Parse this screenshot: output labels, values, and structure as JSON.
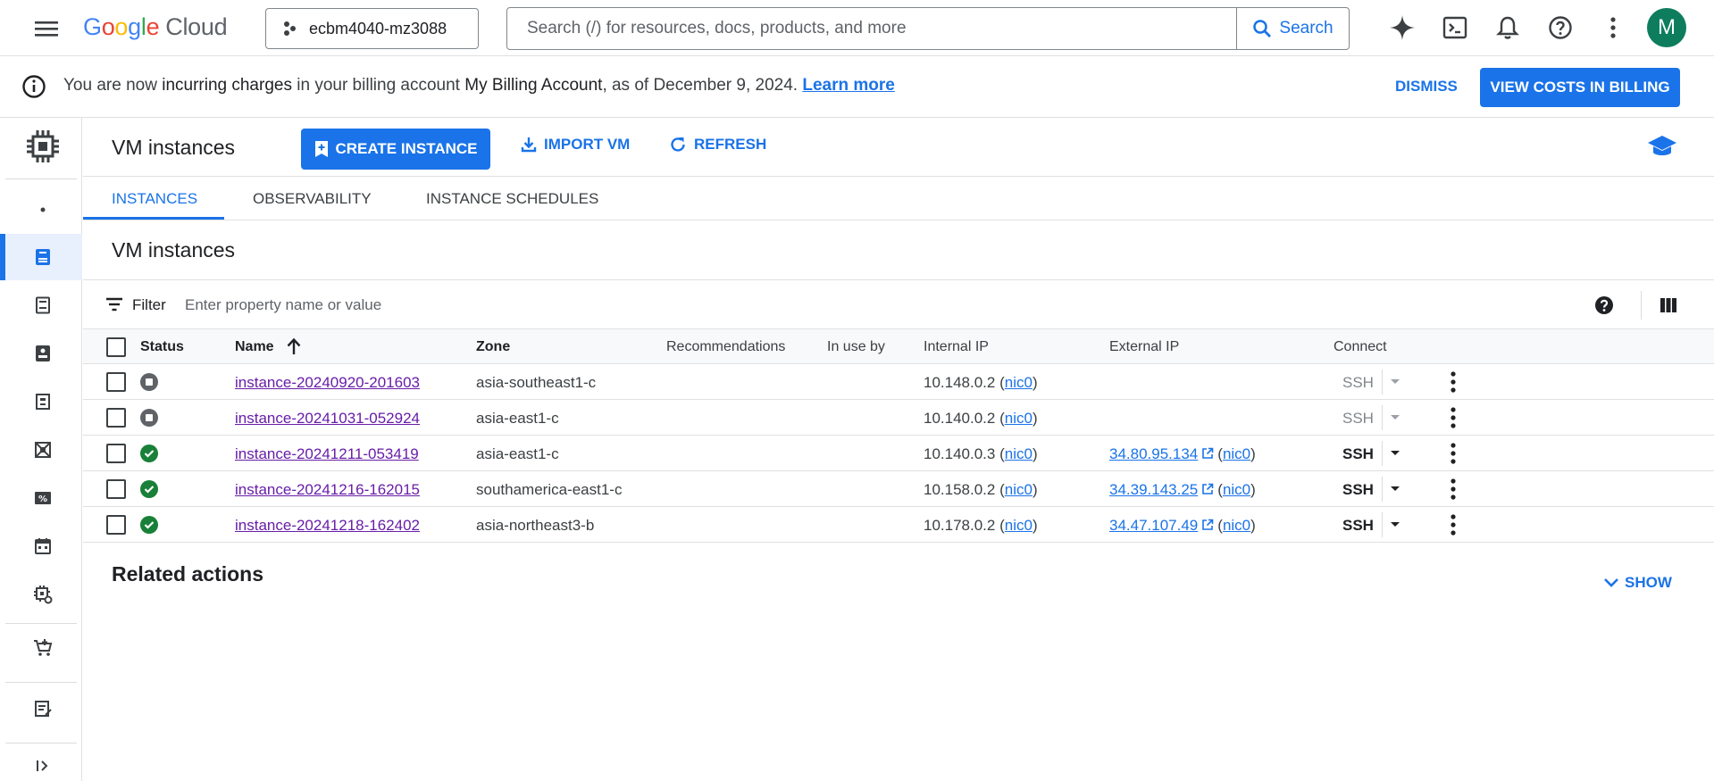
{
  "app": {
    "logo_letters": [
      "G",
      "o",
      "o",
      "g",
      "l",
      "e"
    ],
    "logo_suffix": "Cloud",
    "project": "ecbm4040-mz3088",
    "search_placeholder": "Search (/) for resources, docs, products, and more",
    "search_label": "Search",
    "avatar_initial": "M"
  },
  "banner": {
    "pre": "You are now ",
    "incurring": "incurring charges",
    "mid": " in your billing account ",
    "account": "My Billing Account",
    "post": ", as of December 9, 2024. ",
    "learn_more": "Learn more",
    "dismiss": "DISMISS",
    "view_costs": "VIEW COSTS IN BILLING"
  },
  "header": {
    "title": "VM instances",
    "create": "CREATE INSTANCE",
    "import": "IMPORT VM",
    "refresh": "REFRESH"
  },
  "tabs": [
    "INSTANCES",
    "OBSERVABILITY",
    "INSTANCE SCHEDULES"
  ],
  "section_title": "VM instances",
  "filter": {
    "label": "Filter",
    "placeholder": "Enter property name or value"
  },
  "table": {
    "headers": {
      "status": "Status",
      "name": "Name",
      "zone": "Zone",
      "recommendations": "Recommendations",
      "in_use_by": "In use by",
      "internal_ip": "Internal IP",
      "external_ip": "External IP",
      "connect": "Connect"
    },
    "rows": [
      {
        "status": "stopped",
        "name": "instance-20240920-201603",
        "zone": "asia-southeast1-c",
        "internal_ip": "10.148.0.2",
        "nic": "nic0",
        "external_ip": "",
        "ssh": "SSH"
      },
      {
        "status": "stopped",
        "name": "instance-20241031-052924",
        "zone": "asia-east1-c",
        "internal_ip": "10.140.0.2",
        "nic": "nic0",
        "external_ip": "",
        "ssh": "SSH"
      },
      {
        "status": "running",
        "name": "instance-20241211-053419",
        "zone": "asia-east1-c",
        "internal_ip": "10.140.0.3",
        "nic": "nic0",
        "external_ip": "34.80.95.134",
        "ssh": "SSH"
      },
      {
        "status": "running",
        "name": "instance-20241216-162015",
        "zone": "southamerica-east1-c",
        "internal_ip": "10.158.0.2",
        "nic": "nic0",
        "external_ip": "34.39.143.25",
        "ssh": "SSH"
      },
      {
        "status": "running",
        "name": "instance-20241218-162402",
        "zone": "asia-northeast3-b",
        "internal_ip": "10.178.0.2",
        "nic": "nic0",
        "external_ip": "34.47.107.49",
        "ssh": "SSH"
      }
    ]
  },
  "related": {
    "title": "Related actions",
    "show": "SHOW"
  },
  "colors": {
    "accent": "#1a73e8",
    "running": "#188038",
    "stopped": "#5f6368",
    "visited_link": "#681da8",
    "avatar": "#0d7d5e"
  }
}
